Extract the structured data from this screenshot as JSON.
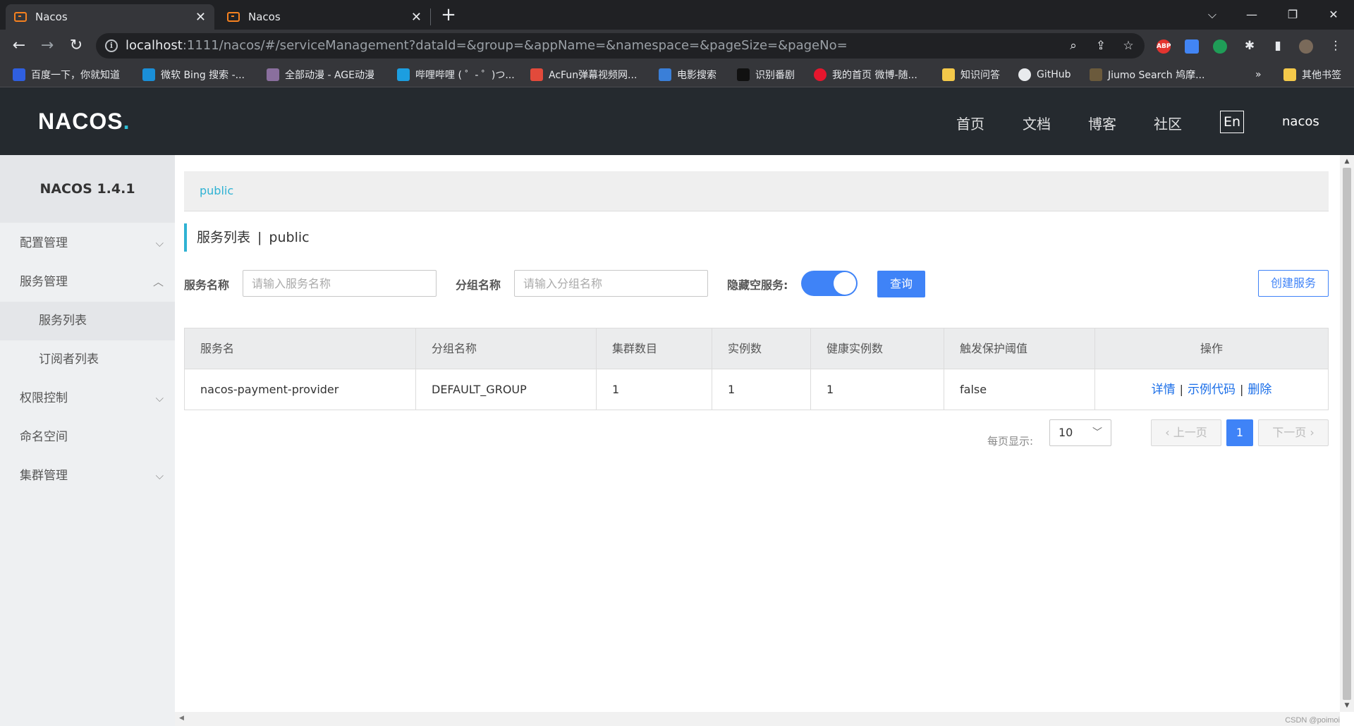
{
  "browser": {
    "tabs": [
      {
        "title": "Nacos",
        "active": true
      },
      {
        "title": "Nacos",
        "active": false
      }
    ],
    "url_host": "localhost",
    "url_rest": ":1111/nacos/#/serviceManagement?dataId=&group=&appName=&namespace=&pageSize=&pageNo=",
    "extensions": [
      "ABP"
    ],
    "bookmarks": [
      {
        "label": "百度一下，你就知道",
        "color": "#2f5fe0"
      },
      {
        "label": "微软 Bing 搜索 -...",
        "color": "#1a8fd8"
      },
      {
        "label": "全部动漫 - AGE动漫",
        "color": "#8a6f9e"
      },
      {
        "label": "哔哩哔哩 ( ゜- ゜)つ...",
        "color": "#1c9ee0"
      },
      {
        "label": "AcFun弹幕视频网...",
        "color": "#e24a3b"
      },
      {
        "label": "电影搜索",
        "color": "#3a7fd8"
      },
      {
        "label": "识别番剧",
        "color": "#111111"
      },
      {
        "label": "我的首页 微博-随...",
        "color": "#e6162d"
      },
      {
        "label": "知识问答",
        "color": "#f4c94a"
      },
      {
        "label": "GitHub",
        "color": "#e8eaed"
      },
      {
        "label": "Jiumo Search 鸠摩...",
        "color": "#6b5a3c"
      }
    ],
    "more_bookmarks": "»",
    "other_bookmarks": "其他书签"
  },
  "app": {
    "logo": "NACOS",
    "logo_dot": ".",
    "nav": [
      "首页",
      "文档",
      "博客",
      "社区"
    ],
    "lang_button": "En",
    "username": "nacos"
  },
  "sidebar": {
    "version": "NACOS 1.4.1",
    "items": [
      {
        "label": "配置管理",
        "chevron": "down"
      },
      {
        "label": "服务管理",
        "chevron": "up"
      },
      {
        "label": "服务列表",
        "sub": true,
        "active": true
      },
      {
        "label": "订阅者列表",
        "sub": true
      },
      {
        "label": "权限控制",
        "chevron": "down"
      },
      {
        "label": "命名空间"
      },
      {
        "label": "集群管理",
        "chevron": "down"
      }
    ]
  },
  "main": {
    "namespace_link": "public",
    "title": "服务列表",
    "title_sep": "|",
    "title_namespace": "public",
    "filters": {
      "service_name_label": "服务名称",
      "service_name_placeholder": "请输入服务名称",
      "group_name_label": "分组名称",
      "group_name_placeholder": "请输入分组名称",
      "hide_empty_label": "隐藏空服务:",
      "hide_empty_on": true,
      "query_button": "查询",
      "create_button": "创建服务"
    },
    "table": {
      "columns": [
        "服务名",
        "分组名称",
        "集群数目",
        "实例数",
        "健康实例数",
        "触发保护阈值",
        "操作"
      ],
      "rows": [
        {
          "cells": [
            "nacos-payment-provider",
            "DEFAULT_GROUP",
            "1",
            "1",
            "1",
            "false"
          ],
          "actions": [
            "详情",
            "示例代码",
            "删除"
          ]
        }
      ]
    },
    "pagination": {
      "page_size_label": "每页显示:",
      "page_size": "10",
      "prev": "上一页",
      "next": "下一页",
      "current_page": "1"
    }
  },
  "watermark": "CSDN @poimoi"
}
